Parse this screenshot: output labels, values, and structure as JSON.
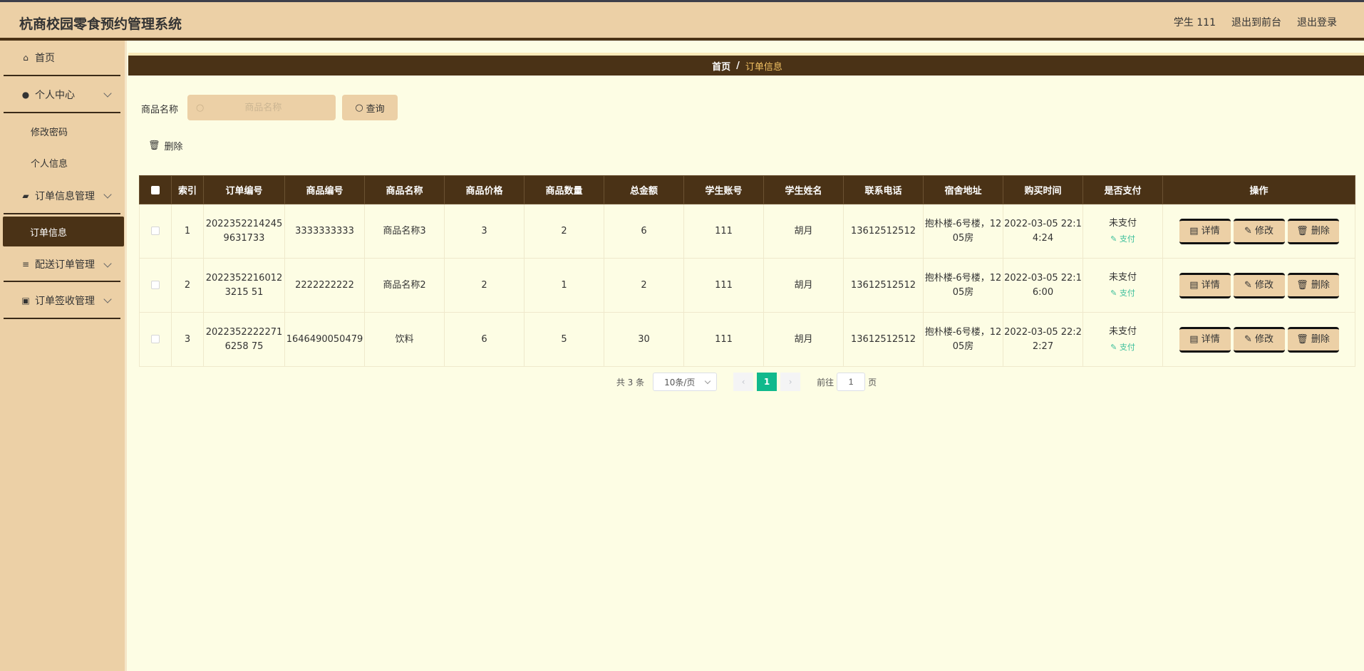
{
  "header": {
    "title": "杭商校园零食预约管理系统",
    "user": "学生 111",
    "to_front": "退出到前台",
    "logout": "退出登录"
  },
  "sidebar": {
    "home": "首页",
    "personal_center": "个人中心",
    "change_password": "修改密码",
    "personal_info": "个人信息",
    "order_mgmt": "订单信息管理",
    "order_info": "订单信息",
    "delivery_mgmt": "配送订单管理",
    "signoff_mgmt": "订单签收管理"
  },
  "breadcrumb": {
    "home": "首页",
    "sep": "/",
    "current": "订单信息"
  },
  "search": {
    "label": "商品名称",
    "placeholder": "商品名称",
    "query_btn": "查询",
    "delete_btn": "删除"
  },
  "table": {
    "columns": [
      "索引",
      "订单编号",
      "商品编号",
      "商品名称",
      "商品价格",
      "商品数量",
      "总金额",
      "学生账号",
      "学生姓名",
      "联系电话",
      "宿舍地址",
      "购买时间",
      "是否支付",
      "操作"
    ],
    "rows": [
      {
        "index": "1",
        "order_no": "20223522142459631733",
        "goods_no": "3333333333",
        "goods_name": "商品名称3",
        "price": "3",
        "qty": "2",
        "total": "6",
        "account": "111",
        "name": "胡月",
        "phone": "13612512512",
        "address": "抱朴楼-6号楼，1205房",
        "time": "2022-03-05 22:14:24",
        "paid": "未支付",
        "pay_link": "支付"
      },
      {
        "index": "2",
        "order_no": "20223522160123215 51",
        "goods_no": "2222222222",
        "goods_name": "商品名称2",
        "price": "2",
        "qty": "1",
        "total": "2",
        "account": "111",
        "name": "胡月",
        "phone": "13612512512",
        "address": "抱朴楼-6号楼，1205房",
        "time": "2022-03-05 22:16:00",
        "paid": "未支付",
        "pay_link": "支付"
      },
      {
        "index": "3",
        "order_no": "20223522222716258 75",
        "goods_no": "1646490050479",
        "goods_name": "饮料",
        "price": "6",
        "qty": "5",
        "total": "30",
        "account": "111",
        "name": "胡月",
        "phone": "13612512512",
        "address": "抱朴楼-6号楼，1205房",
        "time": "2022-03-05 22:22:27",
        "paid": "未支付",
        "pay_link": "支付"
      }
    ],
    "actions": {
      "detail": "详情",
      "edit": "修改",
      "delete": "删除"
    }
  },
  "pagination": {
    "total": "共 3 条",
    "page_size": "10条/页",
    "current_page": "1",
    "goto_label": "前往",
    "goto_value": "1",
    "page_suffix": "页"
  }
}
